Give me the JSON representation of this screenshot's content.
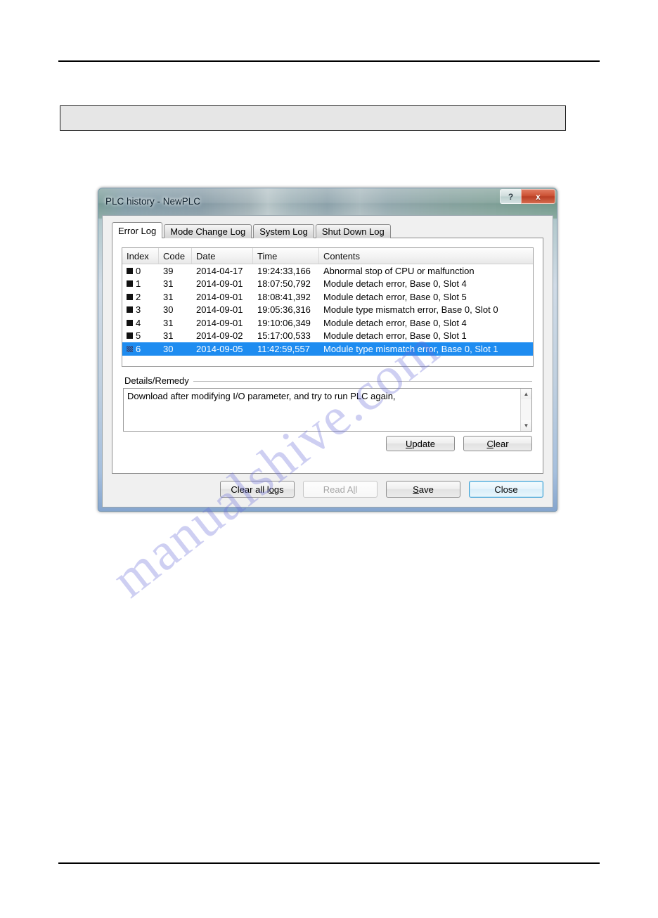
{
  "window": {
    "title": "PLC history - NewPLC",
    "help_button": "?",
    "close_button": "x"
  },
  "tabs": [
    {
      "label": "Error Log",
      "active": true
    },
    {
      "label": "Mode Change Log",
      "active": false
    },
    {
      "label": "System Log",
      "active": false
    },
    {
      "label": "Shut Down Log",
      "active": false
    }
  ],
  "list": {
    "columns": [
      "Index",
      "Code",
      "Date",
      "Time",
      "Contents"
    ],
    "rows": [
      {
        "index": "0",
        "code": "39",
        "date": "2014-04-17",
        "time": "19:24:33,166",
        "contents": "Abnormal stop of CPU or malfunction",
        "selected": false
      },
      {
        "index": "1",
        "code": "31",
        "date": "2014-09-01",
        "time": "18:07:50,792",
        "contents": "Module detach error, Base 0, Slot 4",
        "selected": false
      },
      {
        "index": "2",
        "code": "31",
        "date": "2014-09-01",
        "time": "18:08:41,392",
        "contents": "Module detach error, Base 0, Slot 5",
        "selected": false
      },
      {
        "index": "3",
        "code": "30",
        "date": "2014-09-01",
        "time": "19:05:36,316",
        "contents": "Module type mismatch error, Base 0, Slot 0",
        "selected": false
      },
      {
        "index": "4",
        "code": "31",
        "date": "2014-09-01",
        "time": "19:10:06,349",
        "contents": "Module detach error, Base 0, Slot 4",
        "selected": false
      },
      {
        "index": "5",
        "code": "31",
        "date": "2014-09-02",
        "time": "15:17:00,533",
        "contents": "Module detach error, Base 0, Slot 1",
        "selected": false
      },
      {
        "index": "6",
        "code": "30",
        "date": "2014-09-05",
        "time": "11:42:59,557",
        "contents": "Module type mismatch error, Base 0, Slot 1",
        "selected": true
      }
    ]
  },
  "details": {
    "group_label": "Details/Remedy",
    "text": "Download after modifying I/O parameter, and try to run PLC again,",
    "scroll_up": "▲",
    "scroll_down": "▼"
  },
  "group_buttons": {
    "update": {
      "accel": "U",
      "rest": "pdate"
    },
    "clear": {
      "accel": "C",
      "rest": "lear"
    }
  },
  "bottom_buttons": {
    "clear_all_logs": {
      "pre": "Clear all l",
      "accel": "o",
      "rest": "gs"
    },
    "read_all": {
      "pre": "Read A",
      "accel": "l",
      "rest": "l"
    },
    "save": {
      "accel": "S",
      "rest": "ave"
    },
    "close": {
      "label": "Close"
    }
  },
  "watermark": {
    "text": "manualshive.com"
  },
  "colors": {
    "selection_blue": "#1e8cf0",
    "close_red": "#cc5234",
    "watermark": "#686ad6"
  }
}
